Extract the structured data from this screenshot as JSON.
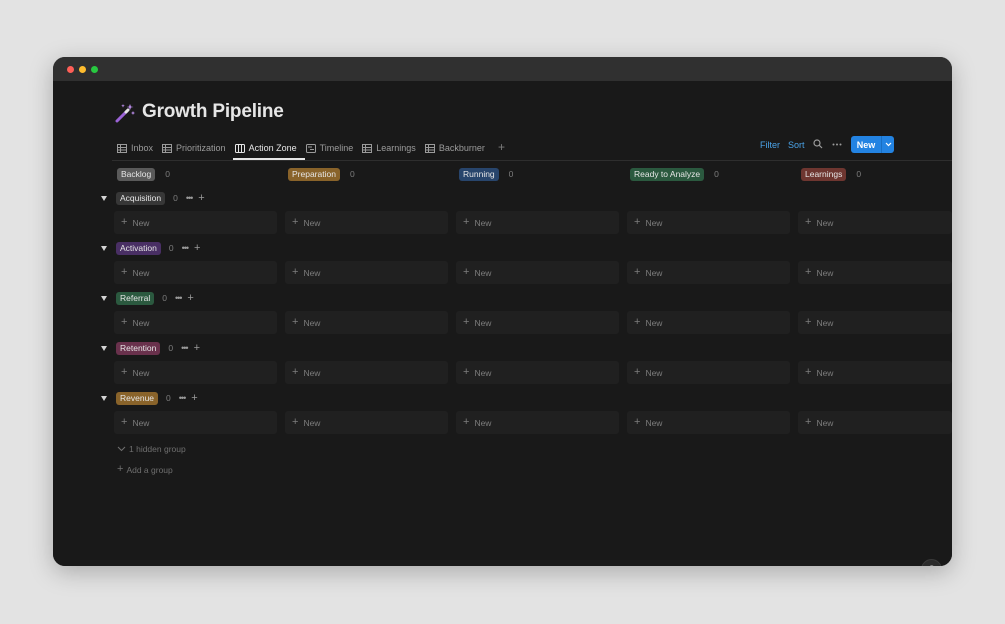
{
  "window": {
    "traffic_lights": {
      "close": "#ff5f57",
      "minimize": "#febc2e",
      "zoom": "#28c840"
    }
  },
  "page": {
    "title": "Growth Pipeline",
    "icon": "magic-wand-icon"
  },
  "tabs": [
    {
      "label": "Inbox",
      "icon": "table-icon",
      "active": false
    },
    {
      "label": "Prioritization",
      "icon": "table-icon",
      "active": false
    },
    {
      "label": "Action Zone",
      "icon": "board-icon",
      "active": true
    },
    {
      "label": "Timeline",
      "icon": "timeline-icon",
      "active": false
    },
    {
      "label": "Learnings",
      "icon": "table-icon",
      "active": false
    },
    {
      "label": "Backburner",
      "icon": "table-icon",
      "active": false
    }
  ],
  "toolbar": {
    "filter_label": "Filter",
    "sort_label": "Sort",
    "new_label": "New",
    "accent": "#2383e2"
  },
  "columns": [
    {
      "label": "Backlog",
      "count": "0",
      "color": "#5a5a5a"
    },
    {
      "label": "Preparation",
      "count": "0",
      "color": "#89632a"
    },
    {
      "label": "Running",
      "count": "0",
      "color": "#28456c"
    },
    {
      "label": "Ready to Analyze",
      "count": "0",
      "color": "#2b593f"
    },
    {
      "label": "Learnings",
      "count": "0",
      "color": "#6e3630"
    }
  ],
  "groups": [
    {
      "label": "Acquisition",
      "count": "0",
      "color": "#373737"
    },
    {
      "label": "Activation",
      "count": "0",
      "color": "#492f64"
    },
    {
      "label": "Referral",
      "count": "0",
      "color": "#2b593f"
    },
    {
      "label": "Retention",
      "count": "0",
      "color": "#69314c"
    },
    {
      "label": "Revenue",
      "count": "0",
      "color": "#89632a"
    }
  ],
  "cell_new_label": "New",
  "hidden_groups_label": "1 hidden group",
  "add_group_label": "Add a group",
  "help_label": "?"
}
